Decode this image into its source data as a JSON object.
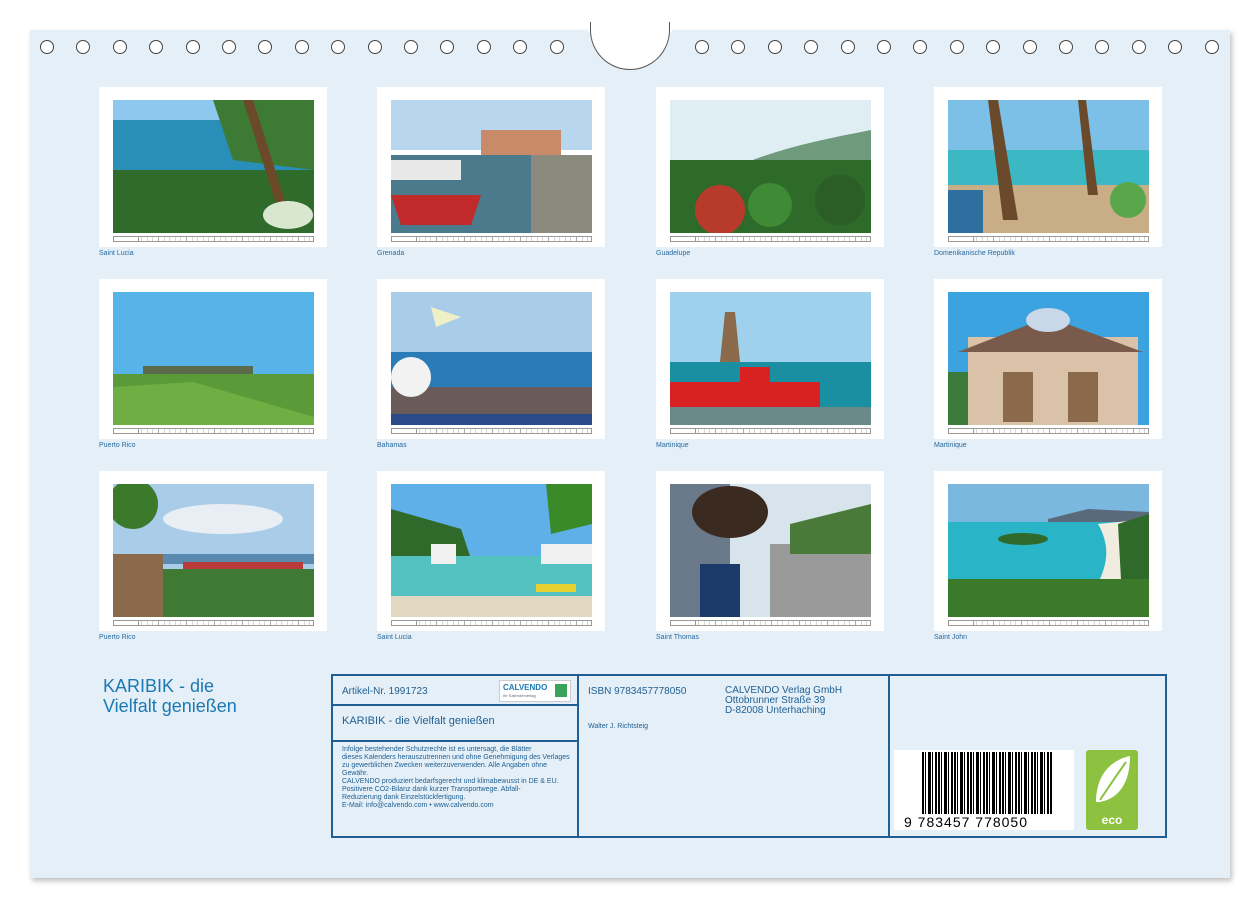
{
  "thumbnails": [
    {
      "caption": "Saint Lucia",
      "scene": "bay"
    },
    {
      "caption": "Grenada",
      "scene": "harbor"
    },
    {
      "caption": "Guadelupe",
      "scene": "forest"
    },
    {
      "caption": "Domenikanische Republik",
      "scene": "beach"
    },
    {
      "caption": "Puerto Rico",
      "scene": "fort"
    },
    {
      "caption": "Bahamas",
      "scene": "ship"
    },
    {
      "caption": "Martinique",
      "scene": "boat"
    },
    {
      "caption": "Martinique",
      "scene": "building"
    },
    {
      "caption": "Puerto Rico",
      "scene": "town"
    },
    {
      "caption": "Saint Lucia",
      "scene": "pier"
    },
    {
      "caption": "Saint Thomas",
      "scene": "street"
    },
    {
      "caption": "Saint John",
      "scene": "lagoon"
    }
  ],
  "title": {
    "line1": "KARIBIK - die",
    "line2": "Vielfalt genießen"
  },
  "info": {
    "article": "Artikel-Nr. 1991723",
    "calvendo_logo": "CALVENDO",
    "calvendo_sub": "Ihr Kalenderverlag",
    "subtitle": "KARIBIK - die Vielfalt genießen",
    "legal": [
      "Infolge bestehender Schutzrechte ist es untersagt, die Blätter",
      "dieses Kalenders herauszutrennen und ohne Genehmigung des Verlages",
      "zu gewerblichen Zwecken weiterzuverwenden. Alle Angaben ohne",
      "Gewähr.",
      "CALVENDO produziert bedarfsgerecht und klimabewusst in DE & EU.",
      "Positivere CO2-Bilanz dank kurzer Transportwege. Abfall-",
      "Reduzierung dank Einzelstückfertigung.",
      "E-Mail: info@calvendo.com • www.calvendo.com"
    ],
    "isbn": "ISBN 9783457778050",
    "author": "Walter J. Richtsteig",
    "publisher": [
      "CALVENDO Verlag GmbH",
      "Ottobrunner Straße 39",
      "D-82008 Unterhaching"
    ],
    "barcode_number": "9 783457 778050",
    "eco_label": "eco"
  }
}
